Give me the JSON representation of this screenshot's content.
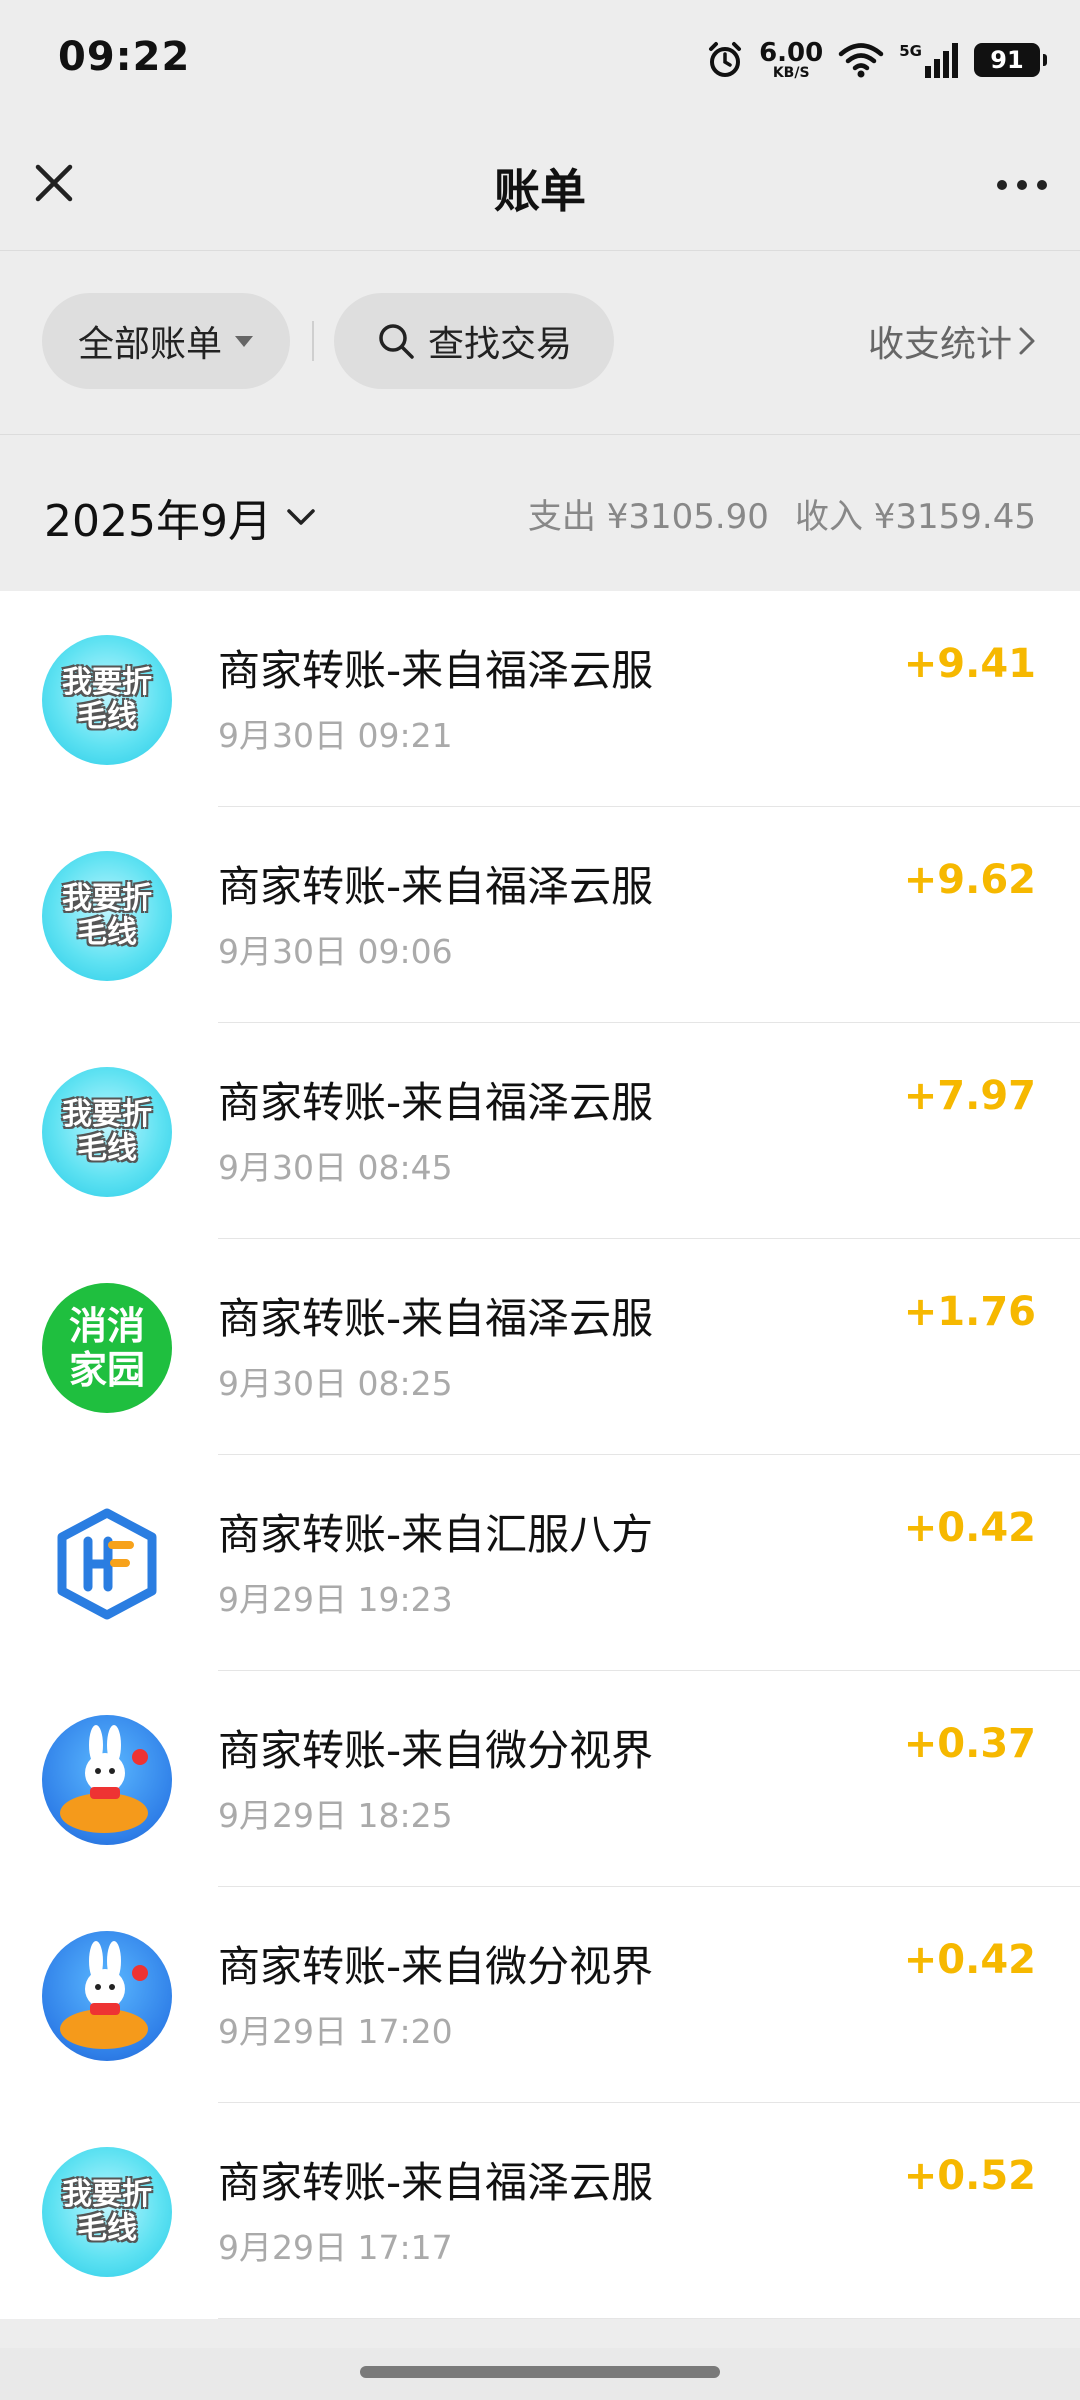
{
  "status_bar": {
    "time": "09:22",
    "net_speed": "6.00",
    "net_unit": "KB/S",
    "network_type": "5G",
    "battery": "91",
    "icons": [
      "alarm-icon",
      "wifi-icon",
      "signal-icon",
      "battery-icon"
    ]
  },
  "nav": {
    "title": "账单",
    "close_icon": "close-icon",
    "more_icon": "more-icon"
  },
  "filters": {
    "all_bills": "全部账单",
    "search": "查找交易",
    "stats": "收支统计"
  },
  "month": {
    "label": "2025年9月",
    "expense": "支出 ¥3105.90",
    "income": "收入 ¥3159.45"
  },
  "transactions": [
    {
      "title": "商家转账-来自福泽云服",
      "time": "9月30日 09:21",
      "amount": "+9.41",
      "avatar": "我要折毛线"
    },
    {
      "title": "商家转账-来自福泽云服",
      "time": "9月30日 09:06",
      "amount": "+9.62",
      "avatar": "我要折毛线"
    },
    {
      "title": "商家转账-来自福泽云服",
      "time": "9月30日 08:45",
      "amount": "+7.97",
      "avatar": "我要折毛线"
    },
    {
      "title": "商家转账-来自福泽云服",
      "time": "9月30日 08:25",
      "amount": "+1.76",
      "avatar": "消消家园"
    },
    {
      "title": "商家转账-来自汇服八方",
      "time": "9月29日 19:23",
      "amount": "+0.42",
      "avatar": "hf-logo"
    },
    {
      "title": "商家转账-来自微分视界",
      "time": "9月29日 18:25",
      "amount": "+0.37",
      "avatar": "rabbit-logo"
    },
    {
      "title": "商家转账-来自微分视界",
      "time": "9月29日 17:20",
      "amount": "+0.42",
      "avatar": "rabbit-logo"
    },
    {
      "title": "商家转账-来自福泽云服",
      "time": "9月29日 17:17",
      "amount": "+0.52",
      "avatar": "我要折毛线"
    }
  ],
  "avatar_text": {
    "fz_line1": "我要折",
    "fz_line2": "毛线",
    "xx_line1": "消消",
    "xx_line2": "家园"
  },
  "colors": {
    "background": "#ededed",
    "list_background": "#ffffff",
    "income_amount": "#f6b800",
    "secondary_text": "#888888"
  }
}
